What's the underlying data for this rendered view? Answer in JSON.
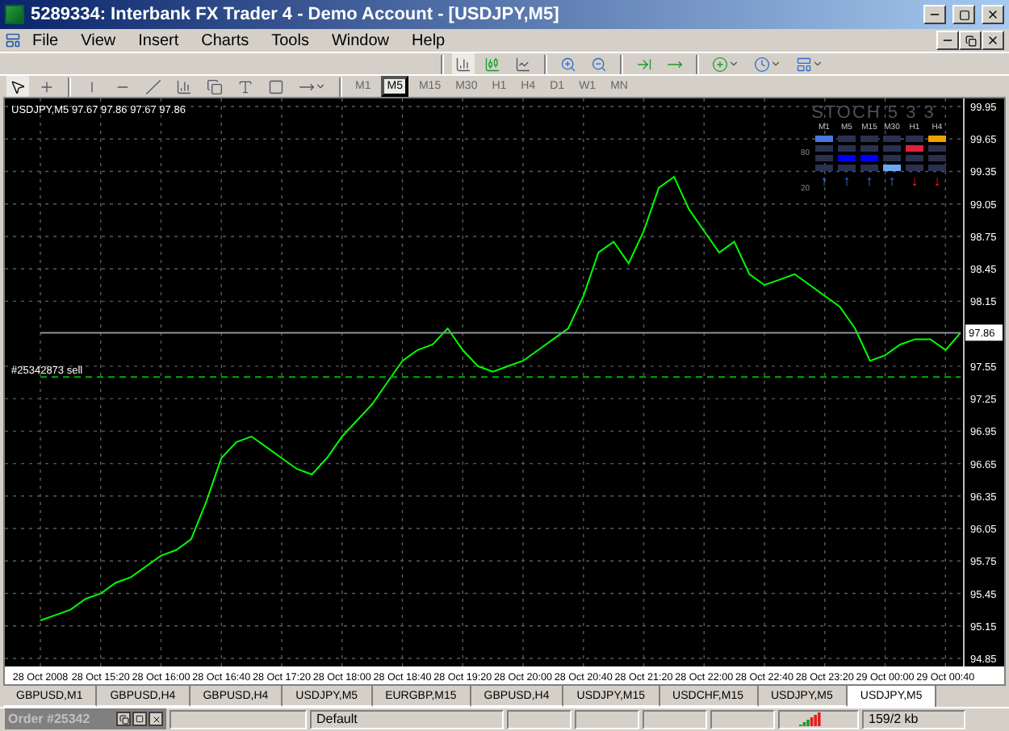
{
  "window": {
    "title": "5289334: Interbank FX Trader 4 - Demo Account - [USDJPY,M5]"
  },
  "menu": [
    "File",
    "View",
    "Insert",
    "Charts",
    "Tools",
    "Window",
    "Help"
  ],
  "timeframes": [
    {
      "label": "M1",
      "selected": false
    },
    {
      "label": "M5",
      "selected": true
    },
    {
      "label": "M15",
      "selected": false
    },
    {
      "label": "M30",
      "selected": false
    },
    {
      "label": "H1",
      "selected": false
    },
    {
      "label": "H4",
      "selected": false
    },
    {
      "label": "D1",
      "selected": false
    },
    {
      "label": "W1",
      "selected": false
    },
    {
      "label": "MN",
      "selected": false
    }
  ],
  "chart": {
    "header_values": "97.67 97.86 97.67 97.86",
    "chart_data": {
      "type": "line",
      "grid": true,
      "ylim": [
        94.85,
        99.95
      ],
      "categories": [
        "28 Oct 2008",
        null,
        null,
        null,
        "28 Oct 15:20",
        null,
        null,
        null,
        "28 Oct 16:00",
        null,
        null,
        null,
        "28 Oct 16:40",
        null,
        null,
        null,
        "28 Oct 17:20",
        null,
        null,
        null,
        "28 Oct 18:00",
        null,
        null,
        null,
        "28 Oct 18:40",
        null,
        null,
        null,
        "28 Oct 19:20",
        null,
        null,
        null,
        "28 Oct 20:00",
        null,
        null,
        null,
        "28 Oct 20:40",
        null,
        null,
        null,
        "28 Oct 21:20",
        null,
        null,
        null,
        "28 Oct 22:00",
        null,
        null,
        null,
        "28 Oct 22:40",
        null,
        null,
        null,
        "28 Oct 23:20",
        null,
        null,
        null,
        "29 Oct 00:00",
        null,
        null,
        null,
        "29 Oct 00:40",
        null
      ],
      "yticks": [
        {
          "value": 99.95,
          "label": "99.95"
        },
        {
          "value": 99.65,
          "label": "99.65"
        },
        {
          "value": 99.35,
          "label": "99.35"
        },
        {
          "value": 99.05,
          "label": "99.05"
        },
        {
          "value": 98.75,
          "label": "98.75"
        },
        {
          "value": 98.45,
          "label": "98.45"
        },
        {
          "value": 98.15,
          "label": "98.15"
        },
        {
          "value": 97.55,
          "label": "97.55"
        },
        {
          "value": 97.25,
          "label": "97.25"
        },
        {
          "value": 96.95,
          "label": "96.95"
        },
        {
          "value": 96.65,
          "label": "96.65"
        },
        {
          "value": 96.35,
          "label": "96.35"
        },
        {
          "value": 96.05,
          "label": "96.05"
        },
        {
          "value": 95.75,
          "label": "95.75"
        },
        {
          "value": 95.45,
          "label": "95.45"
        },
        {
          "value": 95.15,
          "label": "95.15"
        },
        {
          "value": 94.85,
          "label": "94.85"
        }
      ],
      "series": [
        {
          "name": "USDJPY,M5",
          "color": "#00ff00",
          "values": [
            95.2,
            95.25,
            95.3,
            95.4,
            95.45,
            95.55,
            95.6,
            95.7,
            95.8,
            95.85,
            95.95,
            96.3,
            96.7,
            96.85,
            96.9,
            96.8,
            96.7,
            96.6,
            96.55,
            96.7,
            96.9,
            97.05,
            97.2,
            97.4,
            97.6,
            97.7,
            97.75,
            97.9,
            97.7,
            97.55,
            97.5,
            97.55,
            97.6,
            97.7,
            97.8,
            97.9,
            98.2,
            98.6,
            98.7,
            98.5,
            98.8,
            99.2,
            99.3,
            99.0,
            98.8,
            98.6,
            98.7,
            98.4,
            98.3,
            98.35,
            98.4,
            98.3,
            98.2,
            98.1,
            97.9,
            97.6,
            97.65,
            97.75,
            97.8,
            97.8,
            97.7,
            97.86
          ]
        },
        {
          "name": "97.86",
          "color": "#9090a0",
          "values": [
            97.86,
            97.86,
            97.86,
            97.86,
            97.86,
            97.86,
            97.86,
            97.86,
            97.86,
            97.86,
            97.86,
            97.86,
            97.86,
            97.86,
            97.86,
            97.86,
            97.86,
            97.86,
            97.86,
            97.86,
            97.86,
            97.86,
            97.86,
            97.86,
            97.86,
            97.86,
            97.86,
            97.86,
            97.86,
            97.86,
            97.86,
            97.86,
            97.86,
            97.86,
            97.86,
            97.86,
            97.86,
            97.86,
            97.86,
            97.86,
            97.86,
            97.86,
            97.86,
            97.86,
            97.86,
            97.86,
            97.86,
            97.86,
            97.86,
            97.86,
            97.86,
            97.86,
            97.86,
            97.86,
            97.86,
            97.86,
            97.86,
            97.86,
            97.86,
            97.86,
            97.86,
            97.86
          ]
        },
        {
          "name": "#25342873 sell",
          "color": "#00b000",
          "line_style": "dashed",
          "values": [
            97.45,
            97.45,
            97.45,
            97.45,
            97.45,
            97.45,
            97.45,
            97.45,
            97.45,
            97.45,
            97.45,
            97.45,
            97.45,
            97.45,
            97.45,
            97.45,
            97.45,
            97.45,
            97.45,
            97.45,
            97.45,
            97.45,
            97.45,
            97.45,
            97.45,
            97.45,
            97.45,
            97.45,
            97.45,
            97.45,
            97.45,
            97.45,
            97.45,
            97.45,
            97.45,
            97.45,
            97.45,
            97.45,
            97.45,
            97.45,
            97.45,
            97.45,
            97.45,
            97.45,
            97.45,
            97.45,
            97.45,
            97.45,
            97.45,
            97.45,
            97.45,
            97.45,
            97.45,
            97.45,
            97.45,
            97.45,
            97.45,
            97.45,
            97.45,
            97.45,
            97.45,
            97.45
          ]
        }
      ]
    }
  },
  "stoch": {
    "title": "STOCH 5 3 3",
    "levels": [
      "80",
      "20"
    ],
    "columns": [
      {
        "label": "M1",
        "color": "#4a78e0",
        "kind": "up",
        "arrow": "↑",
        "cells": [
          {
            "on": true
          },
          {
            "on": false
          },
          {
            "on": false
          },
          {
            "on": false
          }
        ]
      },
      {
        "label": "M5",
        "color": "#0000ff",
        "kind": "up",
        "arrow": "↑",
        "cells": [
          {
            "on": false
          },
          {
            "on": false
          },
          {
            "on": true
          },
          {
            "on": false
          }
        ]
      },
      {
        "label": "M15",
        "color": "#0000ff",
        "kind": "up",
        "arrow": "↑",
        "cells": [
          {
            "on": false
          },
          {
            "on": false
          },
          {
            "on": true
          },
          {
            "on": false
          }
        ]
      },
      {
        "label": "M30",
        "color": "#6aa8f0",
        "kind": "up",
        "arrow": "↑",
        "cells": [
          {
            "on": false
          },
          {
            "on": false
          },
          {
            "on": false
          },
          {
            "on": true
          }
        ]
      },
      {
        "label": "H1",
        "color": "#e0203c",
        "kind": "down",
        "arrow": "↓",
        "cells": [
          {
            "on": false
          },
          {
            "on": true
          },
          {
            "on": false
          },
          {
            "on": false
          }
        ]
      },
      {
        "label": "H4",
        "color": "#f0a000",
        "kind": "down",
        "arrow": "↓",
        "cells": [
          {
            "on": true
          },
          {
            "on": false
          },
          {
            "on": false
          },
          {
            "on": false
          }
        ]
      }
    ]
  },
  "tabs": [
    {
      "label": "GBPUSD,M1",
      "selected": false
    },
    {
      "label": "GBPUSD,H4",
      "selected": false
    },
    {
      "label": "GBPUSD,H4",
      "selected": false
    },
    {
      "label": "USDJPY,M5",
      "selected": false
    },
    {
      "label": "EURGBP,M15",
      "selected": false
    },
    {
      "label": "GBPUSD,H4",
      "selected": false
    },
    {
      "label": "USDJPY,M15",
      "selected": false
    },
    {
      "label": "USDCHF,M15",
      "selected": false
    },
    {
      "label": "USDJPY,M5",
      "selected": false
    },
    {
      "label": "USDJPY,M5",
      "selected": true
    }
  ],
  "status_bar": {
    "order_panel": "Order #25342",
    "profile": "Default",
    "traffic": "159/2 kb"
  }
}
